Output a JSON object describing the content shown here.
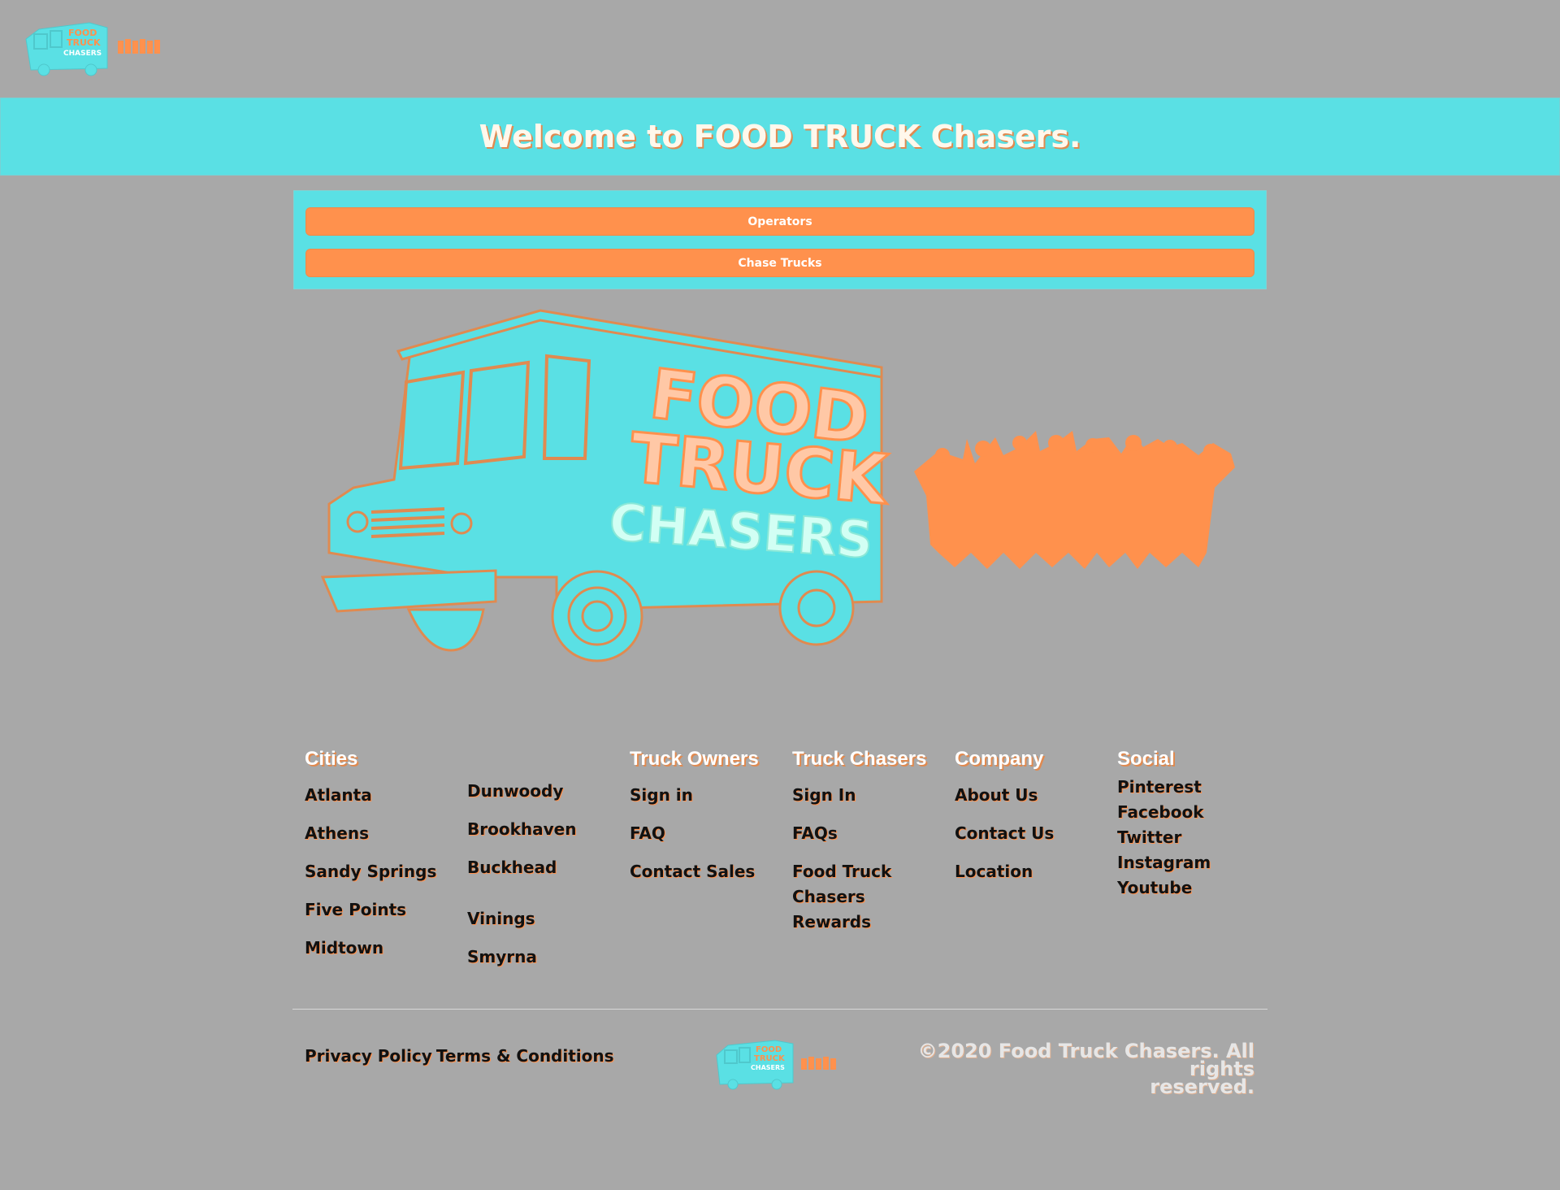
{
  "header": {
    "logo_icon": "food-truck-chasers-logo",
    "welcome": "Welcome to FOOD TRUCK Chasers."
  },
  "actions": {
    "operators": "Operators",
    "chase_trucks": "Chase Trucks"
  },
  "hero": {
    "truck_lines": [
      "FOOD",
      "TRUCK",
      "CHASERS"
    ]
  },
  "footer": {
    "cities": {
      "title": "Cities",
      "col1": [
        "Atlanta",
        "Athens",
        "Sandy Springs",
        "Five Points",
        "Midtown"
      ],
      "col2": [
        "Dunwoody",
        "Brookhaven",
        "Buckhead",
        "Vinings",
        "Smyrna"
      ]
    },
    "truck_owners": {
      "title": "Truck Owners",
      "links": [
        "Sign in",
        "FAQ",
        "Contact Sales"
      ]
    },
    "truck_chasers": {
      "title": "Truck Chasers",
      "links": [
        "Sign In",
        "FAQs",
        "Food Truck",
        "Chasers",
        "Rewards"
      ]
    },
    "company": {
      "title": "Company",
      "links": [
        "About Us",
        "Contact Us",
        "Location"
      ]
    },
    "social": {
      "title": "Social",
      "links": [
        "Pinterest",
        "Facebook",
        "Twitter",
        "Instagram",
        "Youtube"
      ]
    },
    "legal": {
      "privacy": "Privacy Policy",
      "terms": "Terms & Conditions"
    },
    "copyright_line1": "©2020 Food Truck Chasers. All rights",
    "copyright_line2": "reserved."
  },
  "colors": {
    "background": "#a8a8a8",
    "teal": "#5ae0e4",
    "orange": "#ff914d"
  }
}
